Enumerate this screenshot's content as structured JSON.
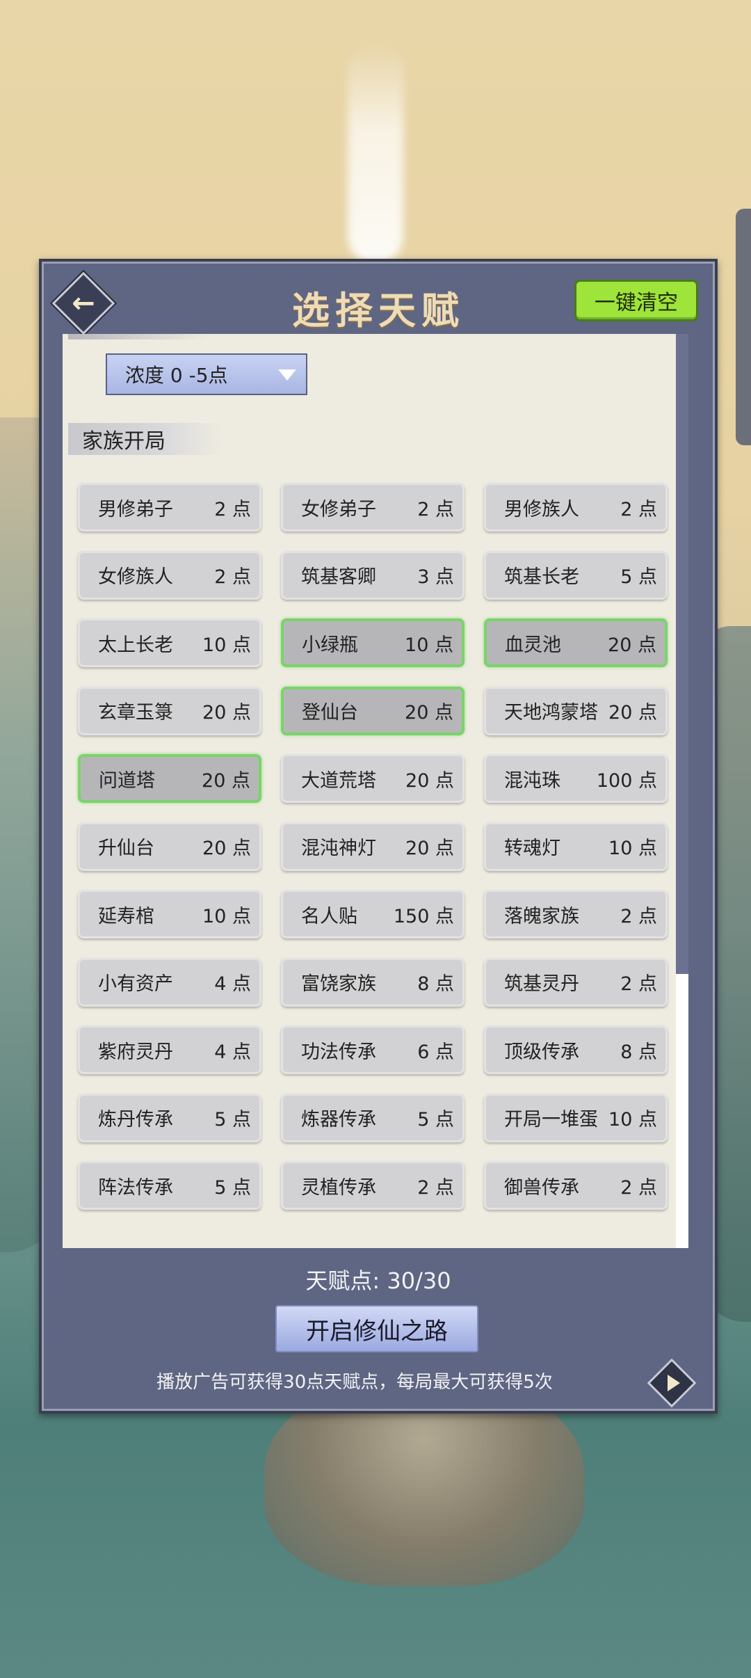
{
  "header": {
    "title": "选择天赋",
    "back_icon": "back-arrow-icon",
    "clear_label": "一键清空"
  },
  "filter": {
    "dropdown_value": "浓度  0  -5点"
  },
  "section": {
    "title": "家族开局"
  },
  "talents": [
    {
      "name": "男修弟子",
      "points": "2 点",
      "selected": false
    },
    {
      "name": "女修弟子",
      "points": "2 点",
      "selected": false
    },
    {
      "name": "男修族人",
      "points": "2 点",
      "selected": false
    },
    {
      "name": "女修族人",
      "points": "2 点",
      "selected": false
    },
    {
      "name": "筑基客卿",
      "points": "3 点",
      "selected": false
    },
    {
      "name": "筑基长老",
      "points": "5 点",
      "selected": false
    },
    {
      "name": "太上长老",
      "points": "10 点",
      "selected": false
    },
    {
      "name": "小绿瓶",
      "points": "10 点",
      "selected": true
    },
    {
      "name": "血灵池",
      "points": "20 点",
      "selected": true
    },
    {
      "name": "玄章玉箓",
      "points": "20 点",
      "selected": false
    },
    {
      "name": "登仙台",
      "points": "20 点",
      "selected": true
    },
    {
      "name": "天地鸿蒙塔",
      "points": "20 点",
      "selected": false
    },
    {
      "name": "问道塔",
      "points": "20 点",
      "selected": true
    },
    {
      "name": "大道荒塔",
      "points": "20 点",
      "selected": false
    },
    {
      "name": "混沌珠",
      "points": "100 点",
      "selected": false
    },
    {
      "name": "升仙台",
      "points": "20 点",
      "selected": false
    },
    {
      "name": "混沌神灯",
      "points": "20 点",
      "selected": false
    },
    {
      "name": "转魂灯",
      "points": "10 点",
      "selected": false
    },
    {
      "name": "延寿棺",
      "points": "10 点",
      "selected": false
    },
    {
      "name": "名人贴",
      "points": "150 点",
      "selected": false
    },
    {
      "name": "落魄家族",
      "points": "2 点",
      "selected": false
    },
    {
      "name": "小有资产",
      "points": "4 点",
      "selected": false
    },
    {
      "name": "富饶家族",
      "points": "8 点",
      "selected": false
    },
    {
      "name": "筑基灵丹",
      "points": "2 点",
      "selected": false
    },
    {
      "name": "紫府灵丹",
      "points": "4 点",
      "selected": false
    },
    {
      "name": "功法传承",
      "points": "6 点",
      "selected": false
    },
    {
      "name": "顶级传承",
      "points": "8 点",
      "selected": false
    },
    {
      "name": "炼丹传承",
      "points": "5 点",
      "selected": false
    },
    {
      "name": "炼器传承",
      "points": "5 点",
      "selected": false
    },
    {
      "name": "开局一堆蛋",
      "points": "10 点",
      "selected": false
    },
    {
      "name": "阵法传承",
      "points": "5 点",
      "selected": false
    },
    {
      "name": "灵植传承",
      "points": "2 点",
      "selected": false
    },
    {
      "name": "御兽传承",
      "points": "2 点",
      "selected": false
    }
  ],
  "footer": {
    "points_text": "天赋点:  30/30",
    "start_label": "开启修仙之路",
    "ad_text": "播放广告可获得30点天赋点，每局最大可获得5次"
  }
}
